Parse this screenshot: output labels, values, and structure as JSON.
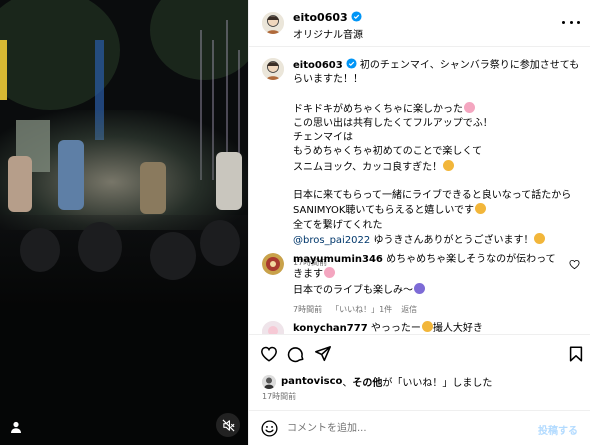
{
  "post": {
    "username": "eito0603",
    "audio_label": "オリジナル音源",
    "caption": {
      "username": "eito0603",
      "first_line": "初のチェンマイ、シャンバラ祭りに参加させてもらいますた！！",
      "line2": "ドキドキがめちゃくちゃに楽しかった",
      "line3": "この思い出は共有したくてフルアップでふ！",
      "line4": "チェンマイは",
      "line5": "もうめちゃくちゃ初めてのことで楽しくて",
      "line6": "スニムヨック、カッコ良すぎた！",
      "line7": "日本に来てもらって一緒にライブできると良いなって話たから",
      "line8": "SANIMYOK聴いてもらえると嬉しいです",
      "line9": "全てを繋げてくれた",
      "mention": "@bros_pai2022",
      "line10_rest": " ゆうきさんありがとうございます！",
      "time": "17時間前"
    },
    "comments": [
      {
        "username": "mayumumin346",
        "text_line1": "めちゃめちゃ楽しそうなのが伝わってきます",
        "text_line2": "日本でのライブも楽しみ〜",
        "time": "7時間前",
        "likes": "「いいね！」1件",
        "reply": "返信"
      },
      {
        "username": "konychan777",
        "text_line1": "やっったー",
        "text_rest": "撮人大好き"
      }
    ],
    "liked_by": {
      "user": "pantovisco",
      "connector": "、",
      "others": "その他",
      "suffix": "が「いいね！」しました"
    },
    "post_time": "17時間前",
    "comment_placeholder": "コメントを追加...",
    "post_button": "投稿する"
  },
  "icons": {
    "more": "more-icon",
    "verified": "verified-badge-icon",
    "heart": "heart-icon",
    "comment": "comment-icon",
    "share": "share-icon",
    "save": "bookmark-icon",
    "emoji": "emoji-icon",
    "mute": "mute-icon",
    "user": "user-icon"
  },
  "colors": {
    "verified": "#0095f6",
    "mention": "#00376b",
    "muted_text": "#737373",
    "post_button": "#b3dbff",
    "divider": "#efefef"
  }
}
